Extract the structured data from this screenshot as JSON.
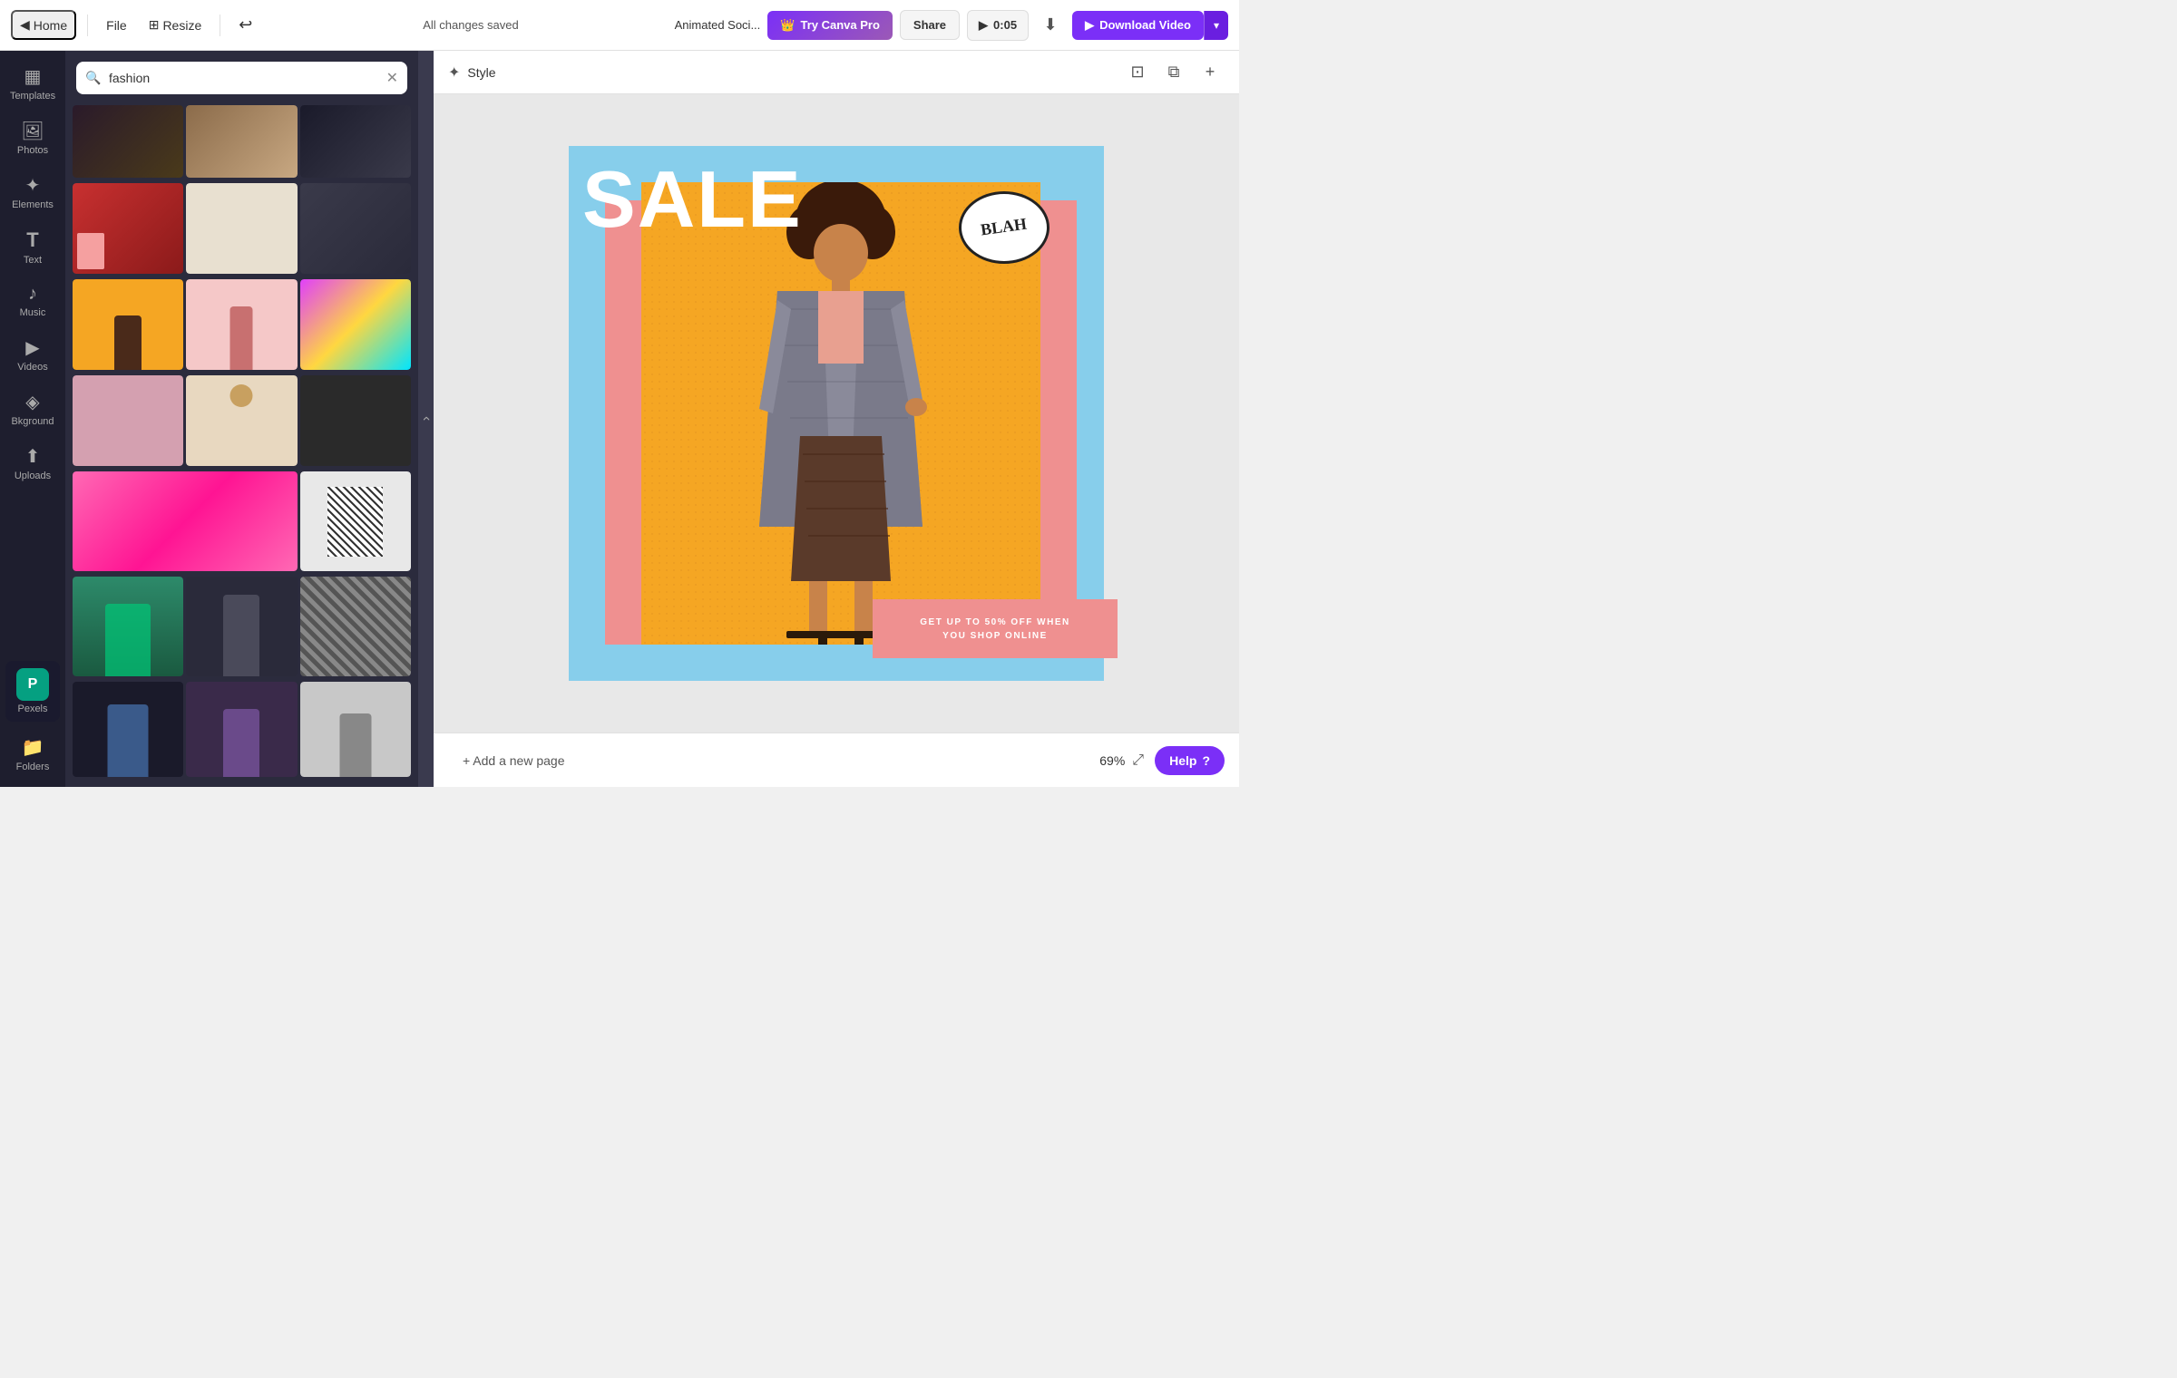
{
  "topbar": {
    "home_label": "Home",
    "file_label": "File",
    "resize_label": "Resize",
    "saved_text": "All changes saved",
    "project_name": "Animated Soci...",
    "try_pro_label": "Try Canva Pro",
    "share_label": "Share",
    "play_time": "0:05",
    "download_video_label": "Download Video",
    "home_icon": "◀",
    "undo_icon": "↩",
    "resize_icon": "⊞",
    "play_icon": "▶",
    "download_icon": "⬇",
    "chevron_icon": "▾"
  },
  "sidebar": {
    "items": [
      {
        "id": "templates",
        "label": "Templates",
        "icon": "▦"
      },
      {
        "id": "photos",
        "label": "Photos",
        "icon": "🖼"
      },
      {
        "id": "elements",
        "label": "Elements",
        "icon": "✦"
      },
      {
        "id": "text",
        "label": "Text",
        "icon": "T"
      },
      {
        "id": "music",
        "label": "Music",
        "icon": "♪"
      },
      {
        "id": "videos",
        "label": "Videos",
        "icon": "▶"
      },
      {
        "id": "background",
        "label": "Bkground",
        "icon": "◈"
      },
      {
        "id": "uploads",
        "label": "Uploads",
        "icon": "⬆"
      },
      {
        "id": "pexels",
        "label": "Pexels",
        "icon": "P"
      },
      {
        "id": "folders",
        "label": "Folders",
        "icon": "📁"
      }
    ]
  },
  "panel": {
    "search_placeholder": "fashion",
    "search_value": "fashion",
    "clear_icon": "✕",
    "search_icon": "🔍"
  },
  "style_bar": {
    "icon": "✦",
    "label": "Style",
    "frame_icon": "⊡",
    "copy_icon": "⧉",
    "add_icon": "+"
  },
  "canvas": {
    "design": {
      "sale_text": "SALE",
      "blah_text": "BLAH",
      "promo_text": "GET UP TO 50% OFF WHEN\nYOU SHOP ONLINE"
    }
  },
  "bottom_bar": {
    "add_page_label": "+ Add a new page",
    "zoom_level": "69%",
    "expand_icon": "⤢",
    "help_label": "Help",
    "help_icon": "?"
  }
}
